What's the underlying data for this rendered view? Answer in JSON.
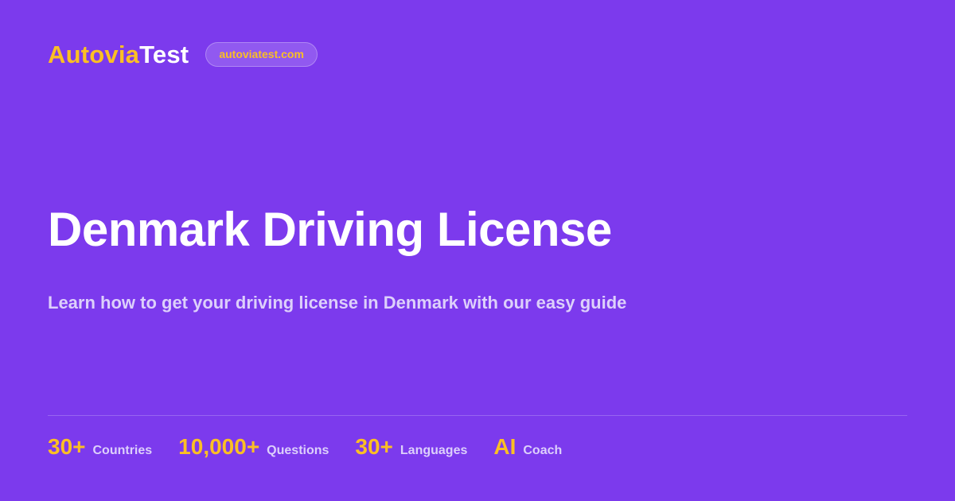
{
  "brand": {
    "logo_part1": "Autovia",
    "logo_part2": "Test",
    "domain": "autoviatest.com"
  },
  "hero": {
    "title": "Denmark Driving License",
    "subtitle": "Learn how to get your driving license in Denmark with our easy guide"
  },
  "stats": [
    {
      "value": "30+",
      "label": "Countries"
    },
    {
      "value": "10,000+",
      "label": "Questions"
    },
    {
      "value": "30+",
      "label": "Languages"
    },
    {
      "value": "AI",
      "label": "Coach"
    }
  ],
  "colors": {
    "background": "#7c3aed",
    "accent": "#fbbf24",
    "text": "#ffffff",
    "muted_text": "#ddd0fb"
  }
}
